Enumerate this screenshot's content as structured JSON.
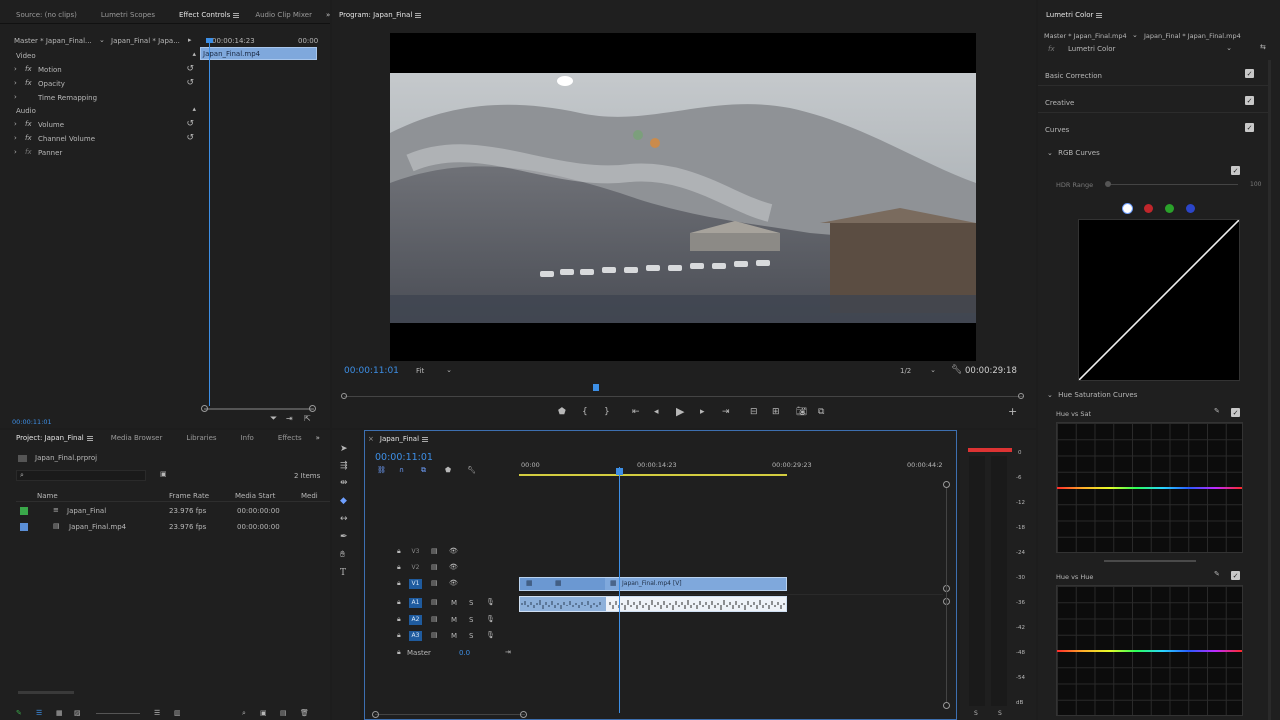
{
  "effect_controls": {
    "tabs": [
      "Source: (no clips)",
      "Lumetri Scopes",
      "Effect Controls",
      "Audio Clip Mixer"
    ],
    "active_tab": "Effect Controls",
    "master_label": "Master * Japan_Final...",
    "clip_label": "Japan_Final * Japa...",
    "time_start": "00:00:14:23",
    "time_end": "00:00",
    "clip_bar": "Japan_Final.mp4",
    "video_section": "Video",
    "video_items": [
      "Motion",
      "Opacity",
      "Time Remapping"
    ],
    "audio_section": "Audio",
    "audio_items": [
      "Volume",
      "Channel Volume",
      "Panner"
    ],
    "fx_badge": "fx",
    "current_time": "00:00:11:01"
  },
  "program": {
    "title": "Program: Japan_Final",
    "timecode": "00:00:11:01",
    "fit": "Fit",
    "resolution": "1/2",
    "duration": "00:00:29:18",
    "playhead_fraction": 0.37
  },
  "lumetri": {
    "title": "Lumetri Color",
    "master": "Master * Japan_Final.mp4",
    "clip": "Japan_Final * Japan_Final.mp4",
    "effect_select": "Lumetri Color",
    "sections": [
      "Basic Correction",
      "Creative",
      "Curves"
    ],
    "rgb_curves": "RGB Curves",
    "hdr_range": "HDR Range",
    "hdr_value": "100",
    "hue_sat_curves": "Hue Saturation Curves",
    "hue_vs_sat": "Hue vs Sat",
    "hue_vs_hue": "Hue vs Hue",
    "channel_colors": [
      "#ffffff",
      "#c0262b",
      "#2aa12a",
      "#2b45c8"
    ]
  },
  "project": {
    "tabs": [
      "Project: Japan_Final",
      "Media Browser",
      "Libraries",
      "Info",
      "Effects"
    ],
    "active_tab": "Project: Japan_Final",
    "file": "Japan_Final.prproj",
    "item_count": "2 Items",
    "columns": [
      "Name",
      "Frame Rate",
      "Media Start",
      "Medi"
    ],
    "rows": [
      {
        "name": "Japan_Final",
        "fps": "23.976 fps",
        "start": "00:00:00:00",
        "color": "#3aa84a"
      },
      {
        "name": "Japan_Final.mp4",
        "fps": "23.976 fps",
        "start": "00:00:00:00",
        "color": "#5b8fd6"
      }
    ]
  },
  "timeline": {
    "title": "Japan_Final",
    "timecode": "00:00:11:01",
    "ruler": [
      "00:00",
      "00:00:14:23",
      "00:00:29:23",
      "00:00:44:2"
    ],
    "tracks_video": [
      "V3",
      "V2",
      "V1"
    ],
    "tracks_audio": [
      "A1",
      "A2",
      "A3"
    ],
    "track_m": "M",
    "track_s": "S",
    "master": "Master",
    "master_value": "0.0",
    "clip_video_label": "Japan_Final.mp4 [V]",
    "meter_labels": [
      "0",
      "-6",
      "-12",
      "-18",
      "-24",
      "-30",
      "-36",
      "-42",
      "-48",
      "-54",
      "dB"
    ],
    "meter_solo": [
      "S",
      "S"
    ]
  }
}
